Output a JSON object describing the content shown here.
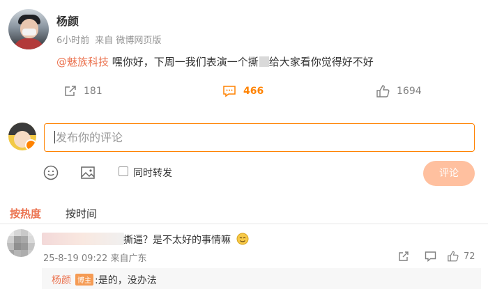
{
  "post": {
    "author": "杨颜",
    "time": "6小时前",
    "source": "来自 微博网页版",
    "mention": "@魅族科技",
    "text_before": " 嘿你好，下周一我们表演一个撕",
    "text_after": "给大家看你觉得好不好",
    "repost_count": "181",
    "comment_count": "466",
    "like_count": "1694"
  },
  "composer": {
    "placeholder": "发布你的评论",
    "sync_label": "同时转发",
    "submit_label": "评论"
  },
  "sort": {
    "hot": "按热度",
    "time": "按时间"
  },
  "comment": {
    "text": "撕逼？是不太好的事情嘛",
    "date": "25-8-19 09:22 来自广东",
    "like_count": "72",
    "reply": {
      "author": "杨颜",
      "tag": "博主",
      "text": ":是的，没办法"
    }
  },
  "colors": {
    "accent": "#ff8200",
    "link": "#eb7350",
    "submit_disabled": "#ffc09f"
  }
}
